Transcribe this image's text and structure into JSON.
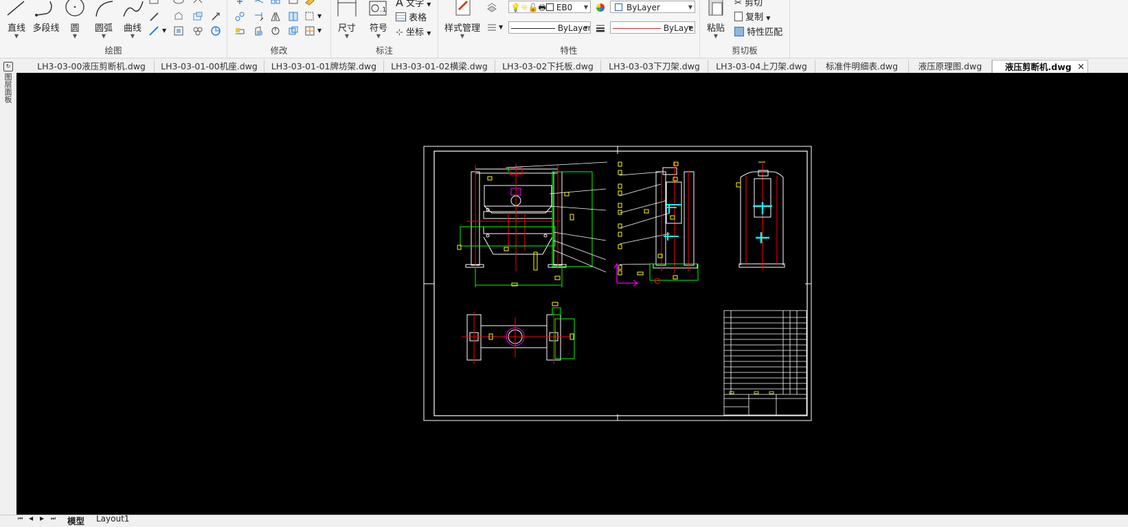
{
  "ribbon": {
    "draw": {
      "title": "绘图",
      "line": "直线",
      "polyline": "多段线",
      "circle": "圆",
      "arc": "圆弧",
      "curve": "曲线"
    },
    "modify": {
      "title": "修改"
    },
    "annotate": {
      "title": "标注",
      "dimension": "尺寸",
      "symbol": "符号",
      "text": "文字",
      "table": "表格",
      "coordinate": "坐标"
    },
    "properties": {
      "title": "特性",
      "style_manager": "样式管理",
      "layer_name": "EB0",
      "color": "ByLayer",
      "linetype": "ByLayer",
      "lineweight": "ByLaye"
    },
    "clipboard": {
      "title": "剪切板",
      "paste": "粘贴",
      "cut": "剪切",
      "copy": "复制",
      "match_properties": "特性匹配"
    }
  },
  "tabs": [
    {
      "label": "LH3-03-00液压剪断机.dwg"
    },
    {
      "label": "LH3-03-01-00机座.dwg"
    },
    {
      "label": "LH3-03-01-01牌坊架.dwg"
    },
    {
      "label": "LH3-03-01-02横梁.dwg"
    },
    {
      "label": "LH3-03-02下托板.dwg"
    },
    {
      "label": "LH3-03-03下刀架.dwg"
    },
    {
      "label": "LH3-03-04上刀架.dwg"
    },
    {
      "label": "标准件明细表.dwg"
    },
    {
      "label": "液压原理图.dwg"
    },
    {
      "label": "液压剪断机.dwg",
      "active": true
    }
  ],
  "tab_close": "×",
  "left_strip_label": "图层面板",
  "layout_tabs": {
    "nav": [
      "⏮",
      "◀",
      "▶",
      "⏭"
    ],
    "model": "模型",
    "layout1": "Layout1"
  },
  "colors": {
    "canvas": "#000000",
    "cad_white": "#ffffff",
    "cad_red": "#ff0000",
    "cad_green": "#00ff00",
    "cad_yellow": "#ffff00",
    "cad_cyan": "#00ffff",
    "cad_magenta": "#ff00ff"
  }
}
